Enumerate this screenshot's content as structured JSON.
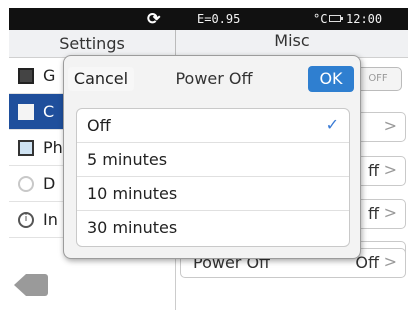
{
  "status_bar": {
    "refresh_icon": "refresh-icon",
    "ev_text": "E=0.95",
    "unit_text": "°C",
    "battery_icon": "battery-icon",
    "clock": "12:00"
  },
  "header": {
    "left_title": "Settings",
    "right_title": "Misc"
  },
  "sidebar": {
    "items": [
      {
        "label": "G",
        "icon": "gear-icon",
        "selected": false
      },
      {
        "label": "C",
        "icon": "camera-icon",
        "selected": true
      },
      {
        "label": "Ph",
        "icon": "photo-icon",
        "selected": false
      },
      {
        "label": "D",
        "icon": "clock-icon",
        "selected": false
      },
      {
        "label": "In",
        "icon": "info-icon",
        "selected": false
      }
    ],
    "back_icon": "back-icon"
  },
  "right_panel": {
    "toggle_label": "OFF",
    "rows": [
      {
        "value": "",
        "chevron": ">"
      },
      {
        "value": "ff",
        "chevron": ">"
      },
      {
        "value": "ff",
        "chevron": ">"
      },
      {
        "value": "ff",
        "chevron": ">"
      },
      {
        "label": "Power Off",
        "value": "Off",
        "chevron": ">"
      }
    ]
  },
  "dialog": {
    "cancel_label": "Cancel",
    "title": "Power Off",
    "ok_label": "OK",
    "selected_check": "✓",
    "options": [
      {
        "label": "Off",
        "selected": true
      },
      {
        "label": "5 minutes",
        "selected": false
      },
      {
        "label": "10 minutes",
        "selected": false
      },
      {
        "label": "30 minutes",
        "selected": false
      }
    ]
  }
}
